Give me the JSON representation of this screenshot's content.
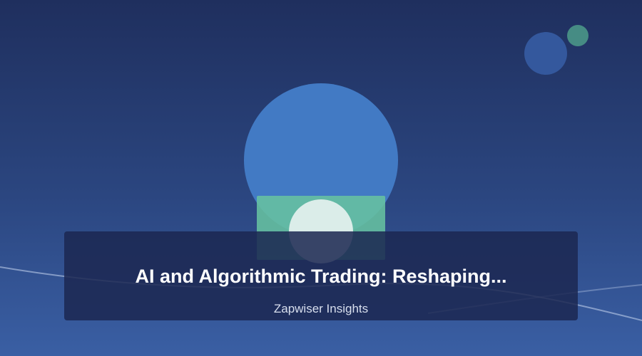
{
  "article_card": {
    "title": "AI and Algorithmic Trading: Reshaping...",
    "source": "Zapwiser Insights"
  },
  "colors": {
    "background_top": "#1f2f5e",
    "background_bottom": "#3a5fa4",
    "illustration_circle": "#427ac4",
    "illustration_rect": "#66c2a0",
    "illustration_small_circle": "#ecf4f2",
    "caption_overlay": "#1c2852",
    "title_text": "#ffffff",
    "source_text": "#d8dfee"
  }
}
